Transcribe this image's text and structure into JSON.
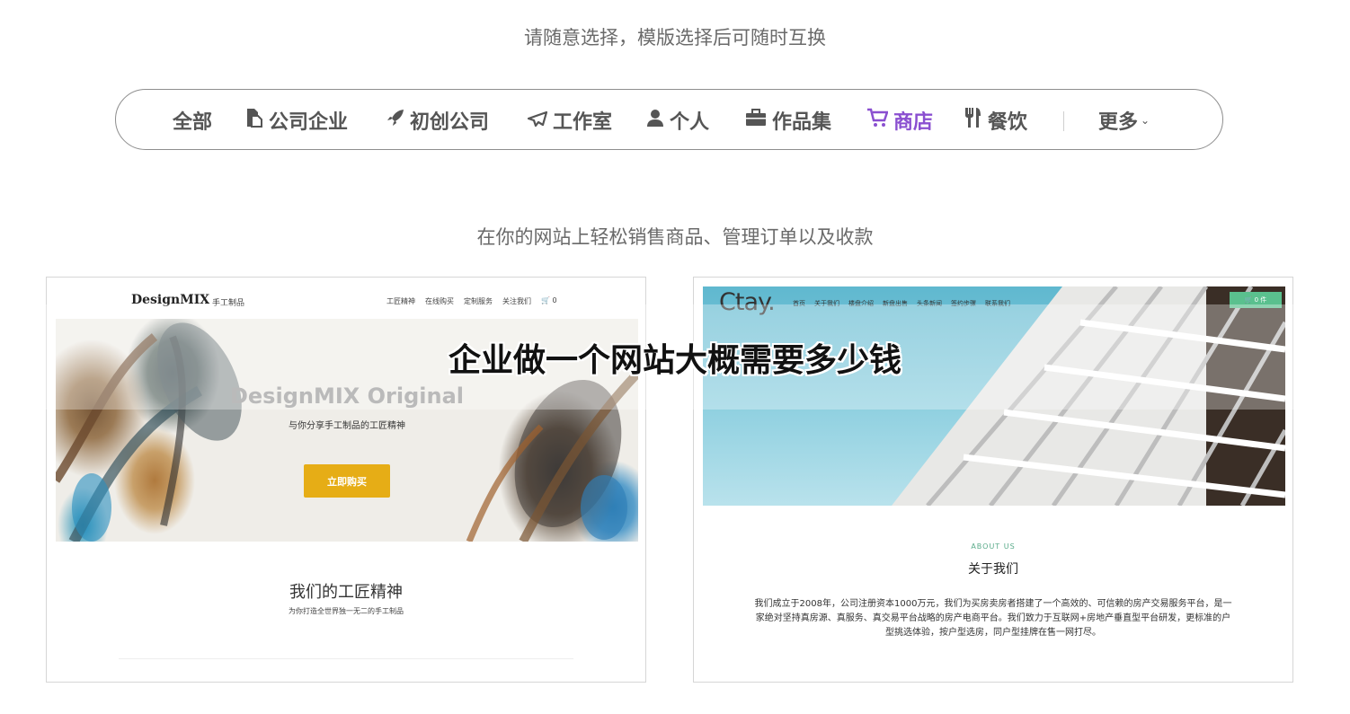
{
  "top_subtitle": "请随意选择，模版选择后可随时互换",
  "filters": {
    "all": "全部",
    "company": "公司企业",
    "startup": "初创公司",
    "studio": "工作室",
    "personal": "个人",
    "portfolio": "作品集",
    "shop": "商店",
    "dining": "餐饮",
    "more": "更多",
    "active": "商店",
    "active_color": "#8a4fd0",
    "icons": {
      "company": "document-icon",
      "startup": "rocket-icon",
      "studio": "paper-plane-icon",
      "personal": "user-icon",
      "portfolio": "briefcase-icon",
      "shop": "cart-icon",
      "dining": "utensils-icon",
      "more": "chevron-down-icon"
    }
  },
  "mid_subtitle": "在你的网站上轻松销售商品、管理订单以及收款",
  "card1": {
    "logo": "DesignMIX",
    "logo_sub": "手工制品",
    "nav": [
      "工匠精神",
      "在线购买",
      "定制服务",
      "关注我们",
      "🛒 0"
    ],
    "hero_title": "DesignMIX Original",
    "hero_subtitle": "与你分享手工制品的工匠精神",
    "buy_button": "立即购买",
    "buy_color": "#e6ad16",
    "section_title": "我们的工匠精神",
    "section_subtitle": "为你打造全世界独一无二的手工制品"
  },
  "card2": {
    "logo": "Ctay.",
    "nav": [
      "首页",
      "关于我们",
      "楼盘介绍",
      "新盘出售",
      "头条新闻",
      "签约步骤",
      "联系我们"
    ],
    "cart": "🛒 0 件",
    "cart_color": "#5ac08e",
    "about_en": "ABOUT US",
    "about_cn": "关于我们",
    "about_text": "我们成立于2008年，公司注册资本1000万元，我们为买房卖房者搭建了一个高效的、可信赖的房产交易服务平台，是一家绝对坚持真房源、真服务、真交易平台战略的房产电商平台。我们致力于互联网+房地产垂直型平台研发，更标准的户型挑选体验，按户型选房，同户型挂牌在售一网打尽。"
  },
  "overlay_title": "企业做一个网站大概需要多少钱"
}
